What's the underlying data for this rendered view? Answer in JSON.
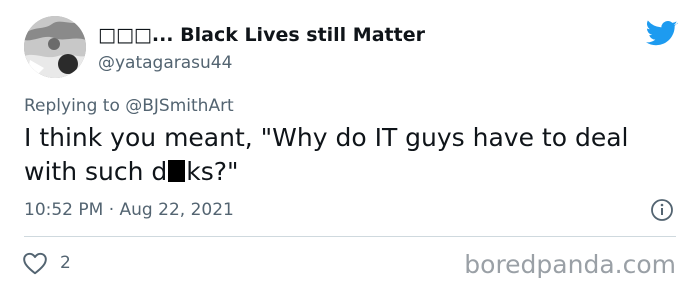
{
  "author": {
    "display_name": "□□□... Black Lives still Matter",
    "handle": "@yatagarasu44",
    "avatar": "avatar"
  },
  "platform_icon": "twitter-bird-icon",
  "reply": {
    "prefix": "Replying to ",
    "mention": "@BJSmithArt"
  },
  "tweet": {
    "text_before": "I think you meant, \"Why do IT guys have to deal\nwith such d",
    "text_after": "ks?\""
  },
  "timestamp": "10:52 PM · Aug 22, 2021",
  "info_icon": "info-icon",
  "likes": {
    "icon": "heart-icon",
    "count": "2"
  },
  "watermark": "boredpanda.com",
  "colors": {
    "twitter_blue": "#1d9bf0",
    "secondary_text": "#536471",
    "primary_text": "#0f1419",
    "divider": "#cfd9de"
  }
}
